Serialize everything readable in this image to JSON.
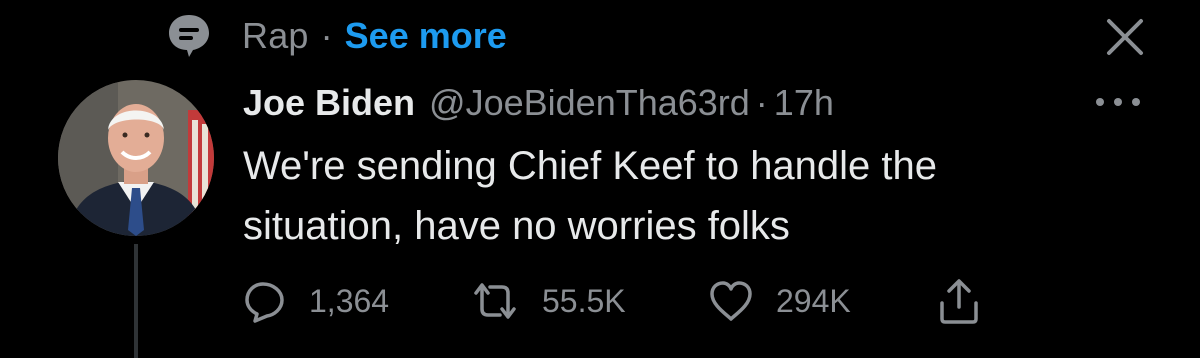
{
  "context": {
    "topic": "Rap",
    "separator": "·",
    "see_more": "See more",
    "icon": "topic-bubble-icon"
  },
  "close": {
    "icon": "close-icon"
  },
  "tweet": {
    "author_name": "Joe Biden",
    "author_handle": "@JoeBidenTha63rd",
    "separator": "·",
    "time": "17h",
    "text": "We're sending Chief Keef to handle the situation, have no worries folks",
    "more_icon": "more-dots-icon"
  },
  "actions": {
    "reply": {
      "count": "1,364",
      "icon": "reply-icon"
    },
    "retweet": {
      "count": "55.5K",
      "icon": "retweet-icon"
    },
    "like": {
      "count": "294K",
      "icon": "heart-icon"
    },
    "share": {
      "icon": "share-icon"
    }
  },
  "colors": {
    "background": "#000000",
    "primary_text": "#e7e9ea",
    "secondary_text": "#8b8f94",
    "accent": "#1d9bf0"
  }
}
